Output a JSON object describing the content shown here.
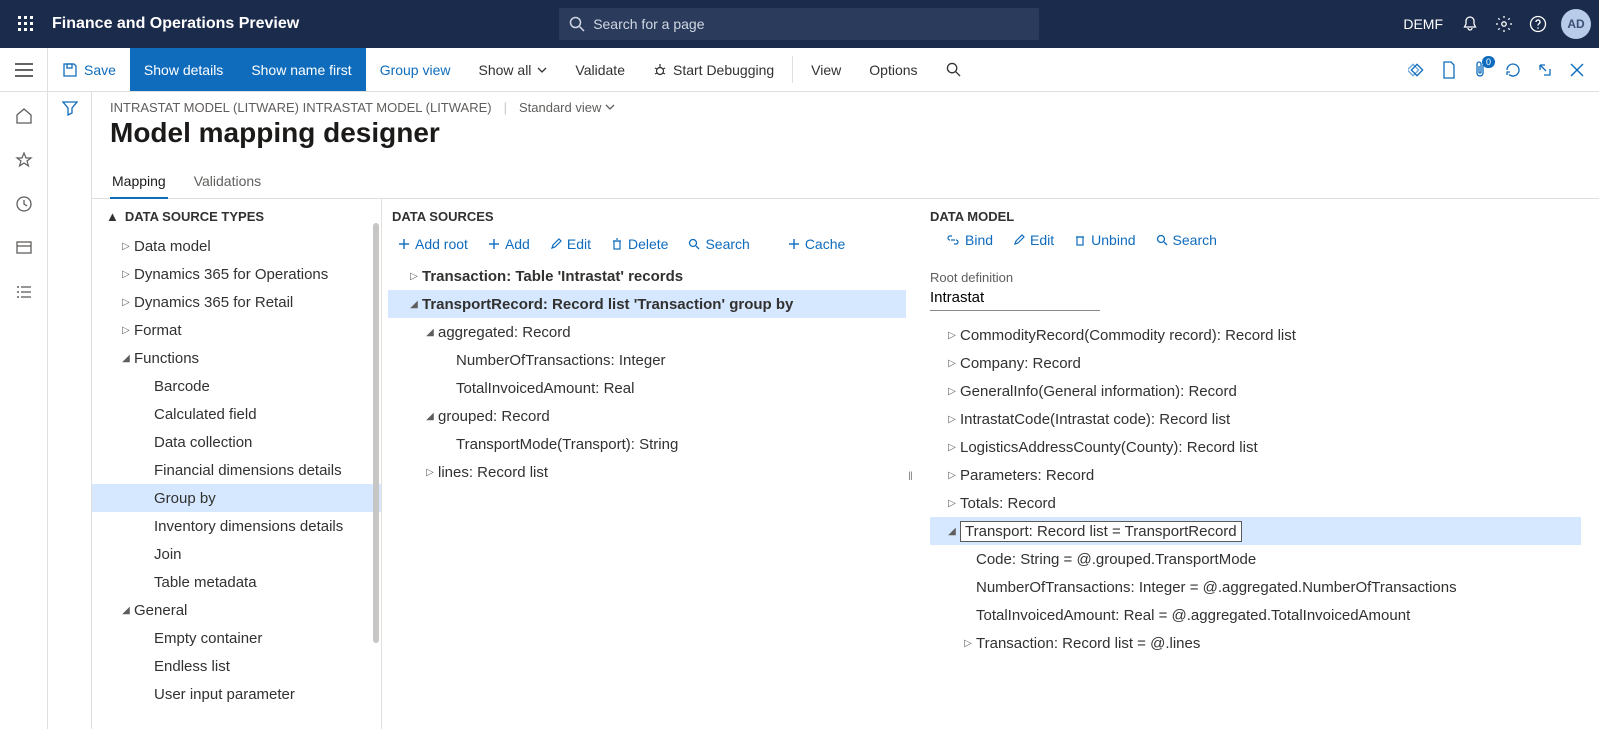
{
  "topbar": {
    "brand": "Finance and Operations Preview",
    "search_placeholder": "Search for a page",
    "company": "DEMF",
    "avatar": "AD"
  },
  "toolbar": {
    "save": "Save",
    "show_details": "Show details",
    "show_name_first": "Show name first",
    "group_view": "Group view",
    "show_all": "Show all",
    "validate": "Validate",
    "start_debugging": "Start Debugging",
    "view": "View",
    "options": "Options",
    "badge": "0"
  },
  "header": {
    "breadcrumb": "INTRASTAT MODEL (LITWARE) INTRASTAT MODEL (LITWARE)",
    "view_selector": "Standard view",
    "title": "Model mapping designer"
  },
  "tabs": {
    "mapping": "Mapping",
    "validations": "Validations"
  },
  "dst": {
    "heading": "DATA SOURCE TYPES",
    "items": [
      "Data model",
      "Dynamics 365 for Operations",
      "Dynamics 365 for Retail",
      "Format",
      "Functions",
      "Barcode",
      "Calculated field",
      "Data collection",
      "Financial dimensions details",
      "Group by",
      "Inventory dimensions details",
      "Join",
      "Table metadata",
      "General",
      "Empty container",
      "Endless list",
      "User input parameter"
    ]
  },
  "ds": {
    "heading": "DATA SOURCES",
    "toolbar": {
      "add_root": "Add root",
      "add": "Add",
      "edit": "Edit",
      "delete": "Delete",
      "search": "Search",
      "cache": "Cache"
    },
    "tree": {
      "transaction": "Transaction: Table 'Intrastat' records",
      "transport_record": "TransportRecord: Record list 'Transaction' group by",
      "aggregated": "aggregated: Record",
      "num_trans": "NumberOfTransactions: Integer",
      "total_inv": "TotalInvoicedAmount: Real",
      "grouped": "grouped: Record",
      "transport_mode": "TransportMode(Transport): String",
      "lines": "lines: Record list"
    }
  },
  "dm": {
    "heading": "DATA MODEL",
    "toolbar": {
      "bind": "Bind",
      "edit": "Edit",
      "unbind": "Unbind",
      "search": "Search"
    },
    "root_label": "Root definition",
    "root_value": "Intrastat",
    "tree": {
      "commodity": "CommodityRecord(Commodity record): Record list",
      "company": "Company: Record",
      "general": "GeneralInfo(General information): Record",
      "intrastat_code": "IntrastatCode(Intrastat code): Record list",
      "logistics": "LogisticsAddressCounty(County): Record list",
      "parameters": "Parameters: Record",
      "totals": "Totals: Record",
      "transport": "Transport: Record list = TransportRecord",
      "code": "Code: String = @.grouped.TransportMode",
      "num_trans": "NumberOfTransactions: Integer = @.aggregated.NumberOfTransactions",
      "total_inv": "TotalInvoicedAmount: Real = @.aggregated.TotalInvoicedAmount",
      "transaction": "Transaction: Record list = @.lines"
    }
  }
}
